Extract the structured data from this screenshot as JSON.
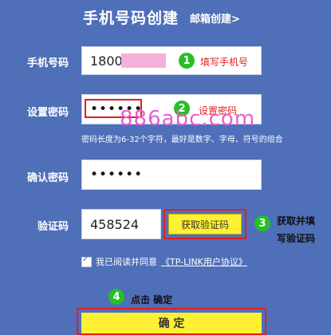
{
  "header": {
    "title": "手机号码创建",
    "email_link": "邮箱创建>"
  },
  "form": {
    "phone": {
      "label": "手机号码",
      "value": "18002"
    },
    "password": {
      "label": "设置密码",
      "value": "••••••"
    },
    "password_hint": "密码长度为6-32个字符，最好是数字、字母、符号的组合",
    "confirm": {
      "label": "确认密码",
      "value": "••••••"
    },
    "code": {
      "label": "验证码",
      "value": "458524",
      "get_code_label": "获取验证码"
    }
  },
  "steps": {
    "one": {
      "number": "1",
      "note": "填写手机号"
    },
    "two": {
      "number": "2",
      "note": "设置密码"
    },
    "three": {
      "number": "3",
      "note_line1": "获取并填",
      "note_line2": "写验证码"
    },
    "four": {
      "number": "4",
      "note": "点击 确定"
    }
  },
  "agreement": {
    "text": "我已阅读并同意",
    "link": "《TP-LINK用户协议》",
    "checked": true
  },
  "confirm_button": {
    "label": "确 定"
  },
  "watermark": "886abc.com",
  "colors": {
    "background": "#4f6fb9",
    "button_yellow": "#fff033",
    "step_green": "#25c024",
    "annotation_red": "#e02020",
    "watermark_pink": "#e85fd0"
  }
}
